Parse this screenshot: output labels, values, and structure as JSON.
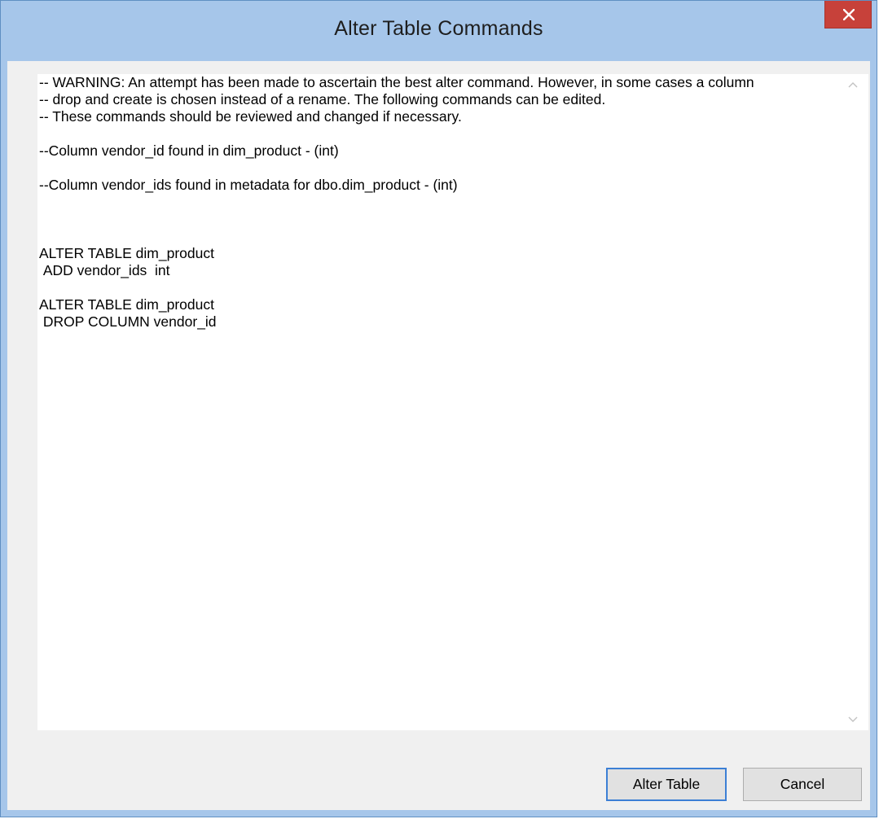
{
  "window": {
    "title": "Alter Table Commands",
    "close_glyph": "✕",
    "close_icon": "close-icon"
  },
  "editor": {
    "content": "-- WARNING: An attempt has been made to ascertain the best alter command. However, in some cases a column\n-- drop and create is chosen instead of a rename. The following commands can be edited.\n-- These commands should be reviewed and changed if necessary.\n\n--Column vendor_id found in dim_product - (int)\n\n--Column vendor_ids found in metadata for dbo.dim_product - (int)\n\n\n\nALTER TABLE dim_product\n ADD vendor_ids  int\n\nALTER TABLE dim_product\n DROP COLUMN vendor_id",
    "scroll_up_icon": "chevron-up-icon",
    "scroll_down_icon": "chevron-down-icon"
  },
  "buttons": {
    "alter_label": "Alter Table",
    "cancel_label": "Cancel"
  },
  "colors": {
    "titlebar": "#a6c6ea",
    "close_button": "#c7413a",
    "default_button_border": "#3c7fd5",
    "dialog_background": "#f0f0f0"
  }
}
